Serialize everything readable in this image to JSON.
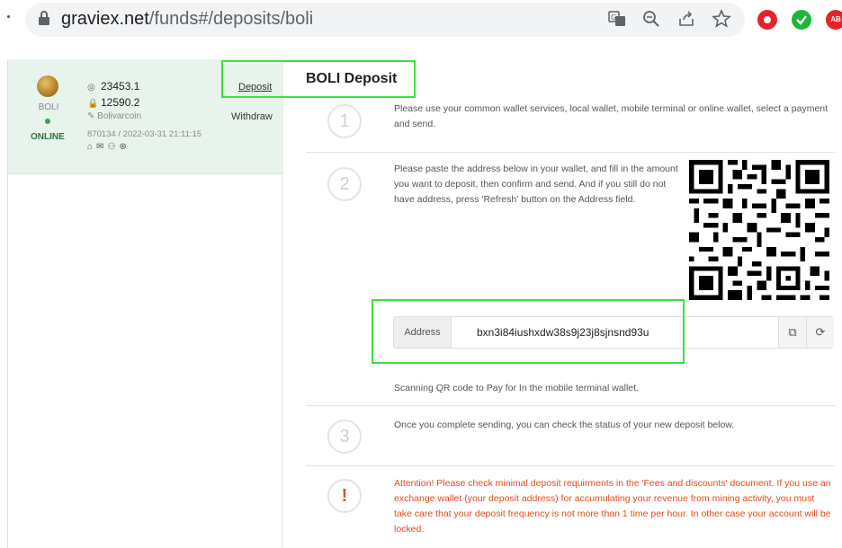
{
  "browser": {
    "url_host": "graviex.net",
    "url_path": "/funds#/deposits/boli"
  },
  "coin": {
    "symbol": "BOLI",
    "status": "ONLINE",
    "balance": "23453.1",
    "locked": "12590.2",
    "name": "Bolivarcoin",
    "block": "870134 / 2022-03-31 21:11:15"
  },
  "nav": {
    "deposit": "Deposit",
    "withdraw": "Withdraw"
  },
  "page_title": "BOLI Deposit",
  "steps": {
    "s1_num": "1",
    "s1_text": "Please use your common wallet services, local wallet, mobile terminal or online wallet, select a payment and send.",
    "s2_num": "2",
    "s2_text": "Please paste the address below in your wallet, and fill in the amount you want to deposit, then confirm and send. And if you still do not have address, press 'Refresh' button on the Address field.",
    "address_label": "Address",
    "address_value": "bxn3i84iushxdw38s9j23j8sjnsnd93u",
    "qr_note": "Scanning QR code to Pay for In the mobile terminal wallet.",
    "s3_num": "3",
    "s3_text": "Once you complete sending, you can check the status of your new deposit below.",
    "warn_num": "!",
    "warn_text": "Attention! Please check minimal deposit requirments in the 'Fees and discounts' document. If you use an exchange wallet (your deposit address) for accumulating your revenue from mining activity, you must take care that your deposit frequency is not more than 1 time per hour. In other case your account will be locked."
  },
  "colors": {
    "highlight": "#3fe03f",
    "online": "#2ea84a",
    "warning": "#e84a1a"
  }
}
